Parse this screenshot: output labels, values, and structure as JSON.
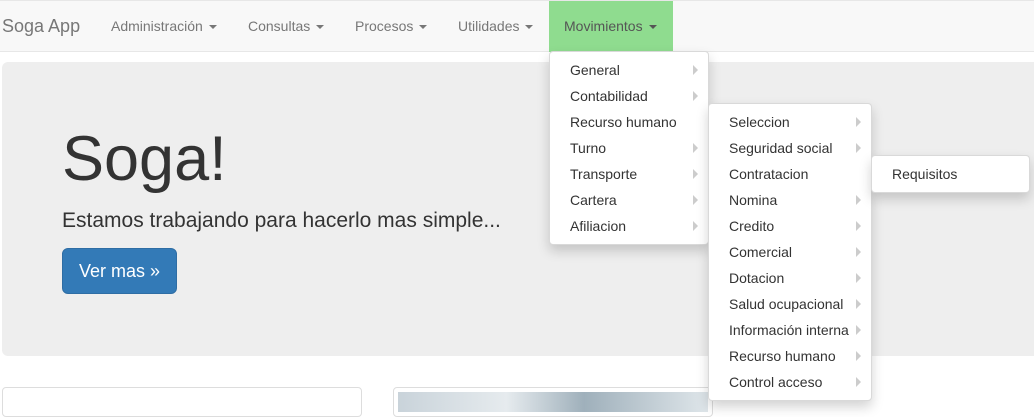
{
  "navbar": {
    "brand": "Soga App",
    "items": [
      {
        "label": "Administración"
      },
      {
        "label": "Consultas"
      },
      {
        "label": "Procesos"
      },
      {
        "label": "Utilidades"
      },
      {
        "label": "Movimientos",
        "active": true
      }
    ],
    "active_color": "#8fdc8f"
  },
  "jumbotron": {
    "title": "Soga!",
    "subtitle": "Estamos trabajando para hacerlo mas simple...",
    "button_label": "Ver mas »",
    "button_color": "#337ab7"
  },
  "menus": {
    "movimientos": [
      {
        "label": "General",
        "submenu": true
      },
      {
        "label": "Contabilidad",
        "submenu": true
      },
      {
        "label": "Recurso humano",
        "submenu": false
      },
      {
        "label": "Turno",
        "submenu": true
      },
      {
        "label": "Transporte",
        "submenu": true
      },
      {
        "label": "Cartera",
        "submenu": true
      },
      {
        "label": "Afiliacion",
        "submenu": true
      }
    ],
    "recurso_humano": [
      {
        "label": "Seleccion",
        "submenu": true
      },
      {
        "label": "Seguridad social",
        "submenu": true
      },
      {
        "label": "Contratacion",
        "submenu": false
      },
      {
        "label": "Nomina",
        "submenu": true
      },
      {
        "label": "Credito",
        "submenu": true
      },
      {
        "label": "Comercial",
        "submenu": true
      },
      {
        "label": "Dotacion",
        "submenu": true
      },
      {
        "label": "Salud ocupacional",
        "submenu": true
      },
      {
        "label": "Información interna",
        "submenu": true
      },
      {
        "label": "Recurso humano",
        "submenu": true
      },
      {
        "label": "Control acceso",
        "submenu": true
      }
    ],
    "contratacion": [
      {
        "label": "Requisitos",
        "submenu": false
      }
    ]
  }
}
